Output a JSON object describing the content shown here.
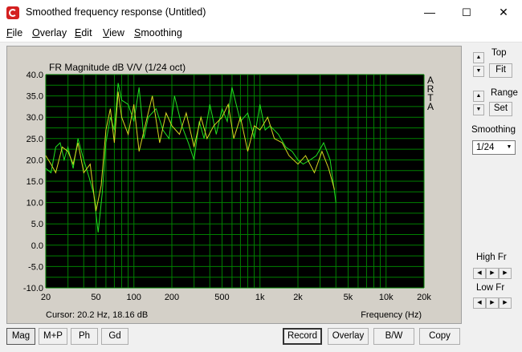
{
  "window": {
    "title": "Smoothed frequency response (Untitled)",
    "min": "—",
    "max": "☐",
    "close": "✕"
  },
  "menu": [
    {
      "u": "F",
      "rest": "ile"
    },
    {
      "u": "O",
      "rest": "verlay"
    },
    {
      "u": "E",
      "rest": "dit"
    },
    {
      "u": "V",
      "rest": "iew"
    },
    {
      "u": "S",
      "rest": "moothing"
    }
  ],
  "plot": {
    "title": "FR Magnitude dB V/V (1/24 oct)",
    "watermark": [
      "A",
      "R",
      "T",
      "A"
    ],
    "cursor": "Cursor: 20.2 Hz, 18.16 dB",
    "xlabel": "Frequency (Hz)",
    "xticks": [
      "20",
      "50",
      "100",
      "200",
      "500",
      "1k",
      "2k",
      "5k",
      "10k",
      "20k"
    ],
    "yticks": [
      "40.0",
      "35.0",
      "30.0",
      "25.0",
      "20.0",
      "15.0",
      "10.0",
      "5.0",
      "0.0",
      "-5.0",
      "-10.0"
    ]
  },
  "colors": {
    "background": "#000000",
    "grid": "#008000",
    "trace_main": "#20e020",
    "trace_overlay": "#d8d820"
  },
  "chart_data": {
    "type": "line",
    "title": "FR Magnitude dB V/V (1/24 oct)",
    "xlabel": "Frequency (Hz)",
    "ylabel": "",
    "xscale": "log",
    "xlim": [
      20,
      20000
    ],
    "ylim": [
      -10,
      40
    ],
    "grid": true,
    "series": [
      {
        "x": [
          20,
          22,
          24,
          26,
          28,
          30,
          33,
          36,
          40,
          44,
          48,
          52,
          56,
          60,
          65,
          70,
          75,
          80,
          90,
          100,
          110,
          120,
          130,
          150,
          170,
          190,
          210,
          240,
          270,
          300,
          330,
          360,
          400,
          450,
          500,
          550,
          600,
          700,
          800,
          900,
          1000,
          1100,
          1200,
          1400,
          1600,
          1800,
          2000,
          2200,
          2500,
          2800,
          3200,
          3600,
          4000
        ],
        "y": [
          18,
          17,
          23,
          24,
          20,
          23,
          18,
          25,
          20,
          16,
          12,
          3,
          12,
          24,
          30,
          27,
          38,
          34,
          33,
          29,
          37,
          25,
          30,
          32,
          27,
          25,
          35,
          28,
          24,
          20,
          29,
          25,
          33,
          26,
          32,
          29,
          37,
          29,
          31,
          25,
          33,
          27,
          28,
          26,
          23,
          22,
          20,
          19,
          20,
          21,
          24,
          20,
          10
        ]
      },
      {
        "x": [
          20,
          22,
          24,
          27,
          30,
          33,
          36,
          40,
          45,
          50,
          55,
          60,
          65,
          70,
          75,
          80,
          90,
          100,
          110,
          125,
          140,
          160,
          180,
          200,
          230,
          260,
          300,
          340,
          380,
          430,
          500,
          560,
          620,
          700,
          800,
          900,
          1000,
          1150,
          1300,
          1500,
          1700,
          2000,
          2300,
          2700,
          3100,
          3500,
          3900
        ],
        "y": [
          21,
          19,
          17,
          23,
          22,
          19,
          24,
          17,
          19,
          8,
          14,
          27,
          32,
          24,
          36,
          30,
          26,
          33,
          22,
          29,
          35,
          24,
          31,
          28,
          26,
          31,
          23,
          30,
          25,
          28,
          30,
          33,
          25,
          30,
          22,
          28,
          27,
          30,
          25,
          24,
          21,
          19,
          21,
          17,
          22,
          18,
          13
        ]
      }
    ]
  },
  "side": {
    "top_label": "Top",
    "fit_label": "Fit",
    "range_label": "Range",
    "set_label": "Set",
    "smoothing_label": "Smoothing",
    "smoothing_value": "1/24",
    "highfr_label": "High Fr",
    "lowfr_label": "Low Fr"
  },
  "bottom": {
    "mag": "Mag",
    "mp": "M+P",
    "ph": "Ph",
    "gd": "Gd",
    "record": "Record",
    "overlay": "Overlay",
    "bw": "B/W",
    "copy": "Copy"
  }
}
